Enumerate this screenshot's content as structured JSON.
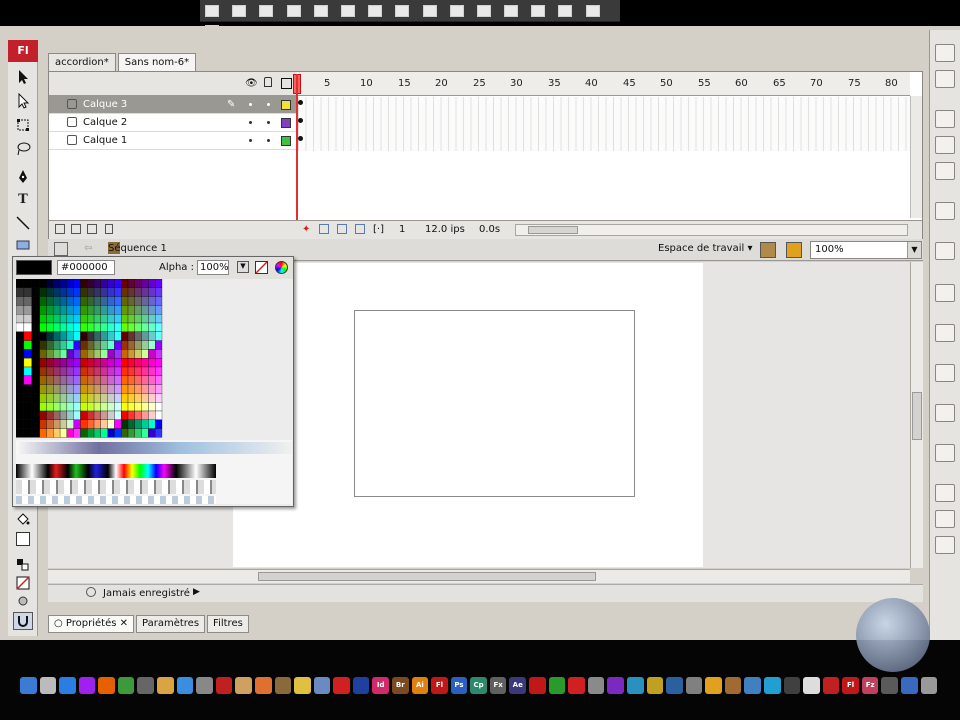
{
  "app": {
    "logo": "Fl"
  },
  "doc_tabs": [
    {
      "label": "accordion*",
      "active": false
    },
    {
      "label": "Sans nom-6*",
      "active": true
    }
  ],
  "timeline": {
    "frame_numbers": [
      "5",
      "10",
      "15",
      "20",
      "25",
      "30",
      "35",
      "40",
      "45",
      "50",
      "55",
      "60",
      "65",
      "70",
      "75",
      "80"
    ],
    "layers": [
      {
        "name": "Calque 3",
        "selected": true,
        "color": "#f0e040"
      },
      {
        "name": "Calque 2",
        "selected": false,
        "color": "#8040c0"
      },
      {
        "name": "Calque 1",
        "selected": false,
        "color": "#40c040"
      }
    ],
    "footer": {
      "current_frame": "1",
      "fps": "12.0 ips",
      "time": "0.0s"
    }
  },
  "editbar": {
    "scene": "Séquence 1",
    "workspace": "Espace de travail",
    "zoom": "100%"
  },
  "swatch_panel": {
    "current_color": "#000000",
    "hex_value": "#000000",
    "alpha_label": "Alpha :",
    "alpha_value": "100%"
  },
  "status": {
    "saved": "Jamais enregistré"
  },
  "properties_tabs": [
    {
      "label": "Propriétés",
      "active": true
    },
    {
      "label": "Paramètres",
      "active": false
    },
    {
      "label": "Filtres",
      "active": false
    }
  ],
  "taskbar_icons": [
    {
      "name": "safari-icon",
      "color": "#3a7bd5"
    },
    {
      "name": "mail-icon",
      "color": "#bbbbbb"
    },
    {
      "name": "ie-icon",
      "color": "#2b7de1"
    },
    {
      "name": "itunes-icon",
      "color": "#a020f0"
    },
    {
      "name": "firefox-icon",
      "color": "#e66000"
    },
    {
      "name": "messenger-icon",
      "color": "#3c9a3c"
    },
    {
      "name": "app-icon",
      "color": "#666666"
    },
    {
      "name": "folder-icon",
      "color": "#d9a441"
    },
    {
      "name": "finder-icon",
      "color": "#3b8de0"
    },
    {
      "name": "monitor-icon",
      "color": "#888888"
    },
    {
      "name": "calendar-icon",
      "color": "#c02020"
    },
    {
      "name": "photo-icon",
      "color": "#d0a060"
    },
    {
      "name": "picture-icon",
      "color": "#e07030"
    },
    {
      "name": "archive-icon",
      "color": "#8a6a3a"
    },
    {
      "name": "notes-icon",
      "color": "#e0c040"
    },
    {
      "name": "doc-icon",
      "color": "#6a8ac0"
    },
    {
      "name": "pdf-icon",
      "color": "#d02020"
    },
    {
      "name": "word-icon",
      "color": "#2040a0"
    },
    {
      "name": "indesign-icon",
      "color": "#d02a6a",
      "label": "Id"
    },
    {
      "name": "bridge-icon",
      "color": "#7a4a20",
      "label": "Br"
    },
    {
      "name": "illustrator-icon",
      "color": "#e08010",
      "label": "Ai"
    },
    {
      "name": "fireworks-icon",
      "color": "#c01818",
      "label": "Fl"
    },
    {
      "name": "photoshop-icon",
      "color": "#2a60c0",
      "label": "Ps"
    },
    {
      "name": "contribute-icon",
      "color": "#2a8a6a",
      "label": "Cp"
    },
    {
      "name": "fx-icon",
      "color": "#606060",
      "label": "Fx"
    },
    {
      "name": "aftereffects-icon",
      "color": "#3a3a7a",
      "label": "Ae"
    },
    {
      "name": "flash-icon",
      "color": "#c01818"
    },
    {
      "name": "app2-icon",
      "color": "#2a9a2a"
    },
    {
      "name": "record-icon",
      "color": "#d02020"
    },
    {
      "name": "sphere-icon",
      "color": "#8a8a8a"
    },
    {
      "name": "media-icon",
      "color": "#7a2ac0"
    },
    {
      "name": "network-icon",
      "color": "#2a90c0"
    },
    {
      "name": "tool-icon",
      "color": "#c0a020"
    },
    {
      "name": "globe-icon",
      "color": "#2a60a0"
    },
    {
      "name": "gear-icon",
      "color": "#808080"
    },
    {
      "name": "sun-icon",
      "color": "#e0a020"
    },
    {
      "name": "user-icon",
      "color": "#a06a30"
    },
    {
      "name": "help-icon",
      "color": "#4080c0"
    },
    {
      "name": "chat-icon",
      "color": "#20a0d0"
    },
    {
      "name": "film-icon",
      "color": "#404040"
    },
    {
      "name": "eject-icon",
      "color": "#dddddd"
    },
    {
      "name": "car-icon",
      "color": "#c02020"
    },
    {
      "name": "flash2-icon",
      "color": "#c01818",
      "label": "Fl"
    },
    {
      "name": "flex-icon",
      "color": "#c04060",
      "label": "Fz"
    },
    {
      "name": "window-icon",
      "color": "#5a5a5a"
    },
    {
      "name": "screen-icon",
      "color": "#3a6ac0"
    },
    {
      "name": "trash-icon",
      "color": "#999999"
    }
  ],
  "colors": {
    "toolbar_bg": "#e6e4e0",
    "chrome_bg": "#d4d0c8",
    "flash_red": "#c2212c"
  }
}
